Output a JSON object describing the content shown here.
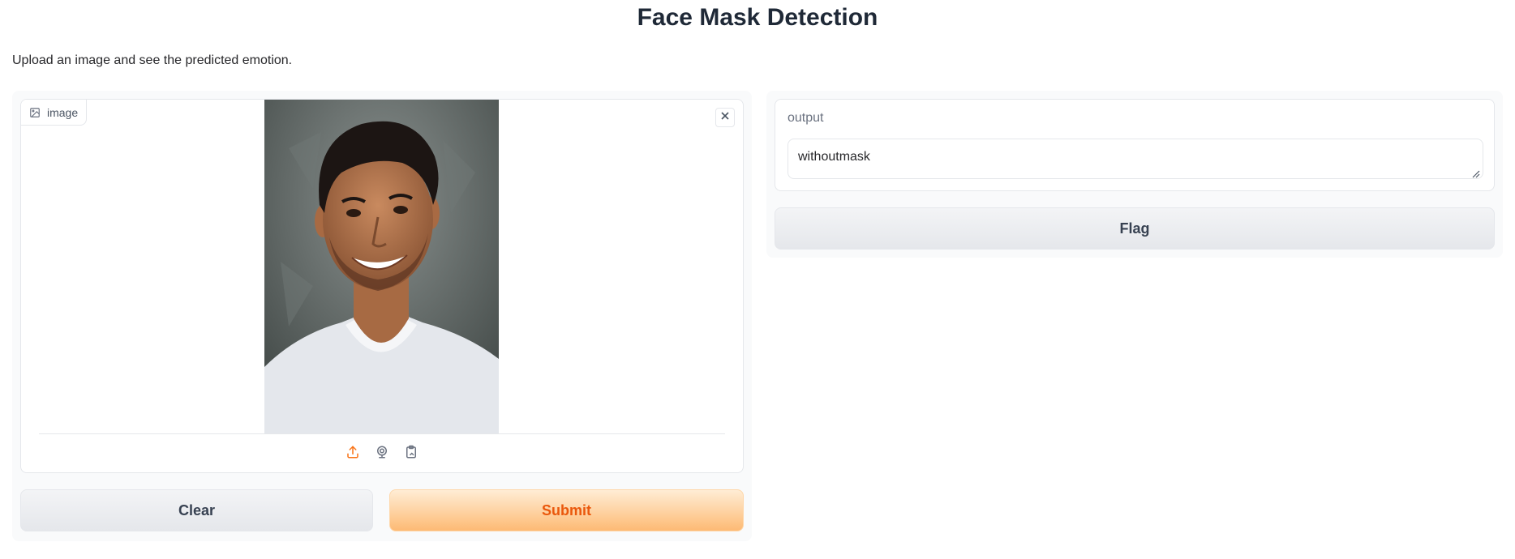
{
  "header": {
    "title": "Face Mask Detection",
    "description": "Upload an image and see the predicted emotion."
  },
  "input": {
    "label": "image",
    "label_icon": "image-icon",
    "clear_icon": "close-icon",
    "sources": [
      {
        "name": "upload-icon",
        "active": true
      },
      {
        "name": "webcam-icon",
        "active": false
      },
      {
        "name": "clipboard-icon",
        "active": false
      }
    ]
  },
  "buttons": {
    "clear_label": "Clear",
    "submit_label": "Submit",
    "flag_label": "Flag"
  },
  "output": {
    "label": "output",
    "value": "withoutmask"
  },
  "colors": {
    "accent": "#f97316",
    "primary_text": "#ea580c",
    "border": "#e5e7eb"
  }
}
